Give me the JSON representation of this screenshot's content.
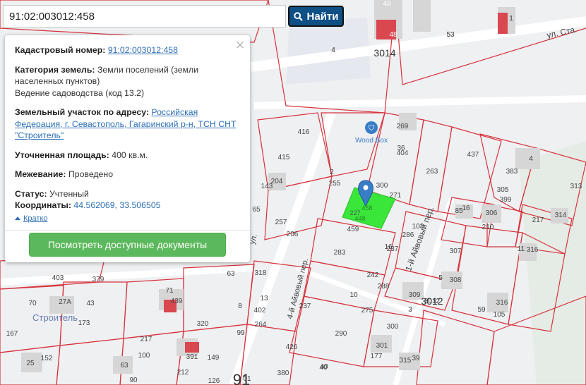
{
  "search": {
    "value": "91:02:003012:458",
    "button_label": "Найти",
    "button_icon": "search-icon"
  },
  "popup": {
    "cadastral_label": "Кадастровый номер:",
    "cadastral_value": "91:02:003012:458",
    "category_label": "Категория земель:",
    "category_value": "Земли поселений (земли населенных пунктов)",
    "category_use": "Ведение садоводства (код 13.2)",
    "address_label": "Земельный участок по адресу:",
    "address_value": "Российская Федерация, г. Севастополь, Гагаринский р-н, ТСН СНТ \"Строитель\"",
    "area_label": "Уточненная площадь:",
    "area_value": "400 кв.м.",
    "survey_label": "Межевание:",
    "survey_value": "Проведено",
    "status_label": "Статус:",
    "status_value": "Учтенный",
    "coords_label": "Координаты:",
    "coords_value": "44.562069, 33.506505",
    "brief_link": "Кратко",
    "docs_button": "Посмотреть доступные документы",
    "close_icon": "close-icon"
  },
  "map": {
    "colors": {
      "background": "#eef0f2",
      "parcel_stroke": "#d8323c",
      "building": "#d6d6d6",
      "highlight": "#39e639",
      "marker": "#3a7dc7",
      "building_red": "#d9474f"
    },
    "labels": {
      "street_top": "ул. Ста",
      "street_lane1": "1-й Айвовый пер.",
      "street_lane4": "4-й Айвовый пер.",
      "street_ul": "ул.",
      "poi": "Wood Box",
      "district": "Строитель",
      "block_3014": "3014",
      "block_3012": "3012",
      "big_91": "91",
      "house_48a": "48",
      "house_48b": "48",
      "house_53": "53",
      "house_1": "1",
      "house_4": "4",
      "parcel_458": "458",
      "parcel_448": "448",
      "parcel_227": "227"
    },
    "parcel_numbers": [
      "416",
      "415",
      "204",
      "143",
      "2",
      "255",
      "300",
      "271",
      "269",
      "36",
      "263",
      "437",
      "383",
      "4",
      "305",
      "399",
      "306",
      "210",
      "16",
      "85",
      "217",
      "313",
      "314",
      "404",
      "103",
      "286",
      "307",
      "11",
      "316",
      "5",
      "308",
      "309",
      "3012",
      "3",
      "300",
      "40",
      "59",
      "316",
      "105",
      "16",
      "237",
      "242",
      "288",
      "275",
      "10",
      "283",
      "459",
      "206",
      "257",
      "65",
      "318",
      "63",
      "13",
      "402",
      "8",
      "237",
      "264",
      "99",
      "426",
      "290",
      "380",
      "40",
      "301",
      "177",
      "315",
      "39",
      "217",
      "391",
      "149",
      "320",
      "71",
      "439",
      "403",
      "379",
      "27А",
      "43",
      "173",
      "70",
      "167",
      "152",
      "25",
      "100",
      "212",
      "126",
      "90",
      "01",
      "63"
    ]
  }
}
